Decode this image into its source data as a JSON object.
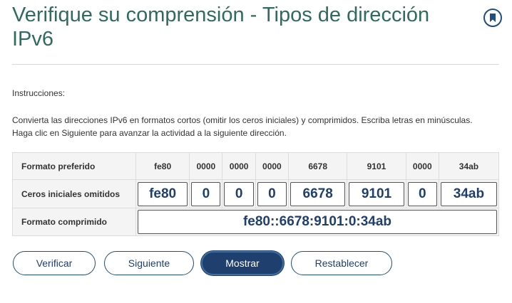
{
  "header": {
    "title": "Verifique su comprensión - Tipos de dirección IPv6",
    "bookmark_icon": "bookmark-icon"
  },
  "instructions": {
    "heading": "Instrucciones:",
    "body": "Convierta las direcciones IPv6 en formatos cortos (omitir los ceros iniciales) y comprimidos. Escriba letras en minúsculas. Haga clic en Siguiente para avanzar la actividad a la siguiente dirección."
  },
  "table": {
    "row_preferred": {
      "label": "Formato preferido",
      "hextets": [
        "fe80",
        "0000",
        "0000",
        "0000",
        "6678",
        "9101",
        "0000",
        "34ab"
      ]
    },
    "row_omitted": {
      "label": "Ceros iniciales omitidos",
      "values": [
        "fe80",
        "0",
        "0",
        "0",
        "6678",
        "9101",
        "0",
        "34ab"
      ]
    },
    "row_compressed": {
      "label": "Formato comprimido",
      "value": "fe80::6678:9101:0:34ab"
    }
  },
  "buttons": {
    "verify": "Verificar",
    "next": "Siguiente",
    "show": "Mostrar",
    "reset": "Restablecer"
  },
  "colors": {
    "title": "#2f6b5e",
    "accent": "#1f3f6f",
    "table_bg": "#f4f4f4"
  }
}
